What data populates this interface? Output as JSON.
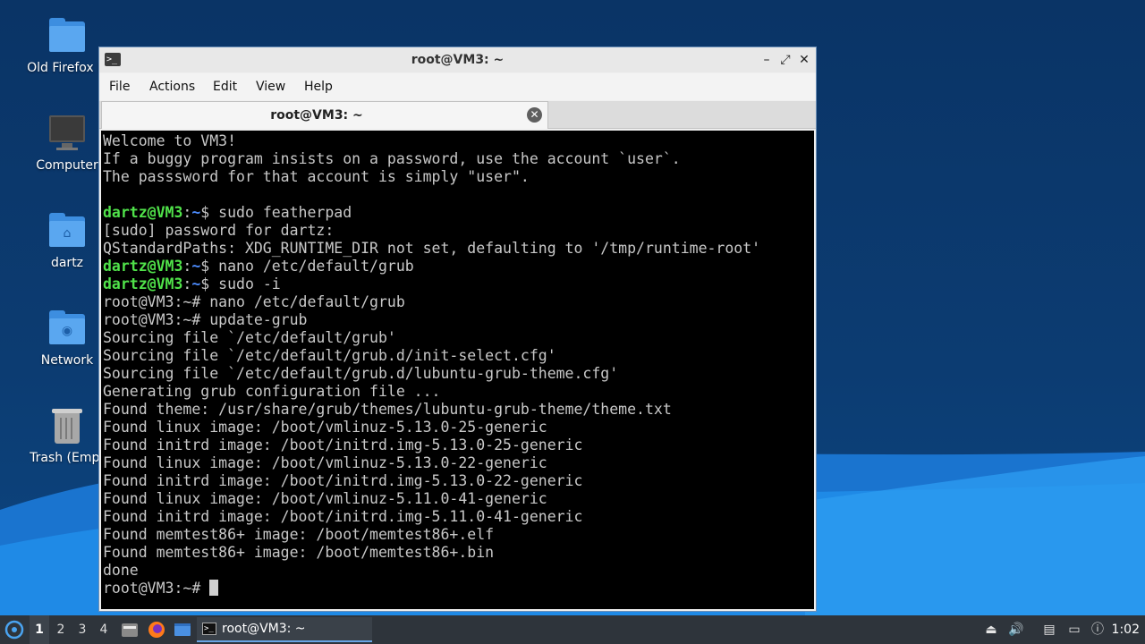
{
  "desktop": {
    "icons": [
      {
        "label": "Old Firefox D",
        "icon": "folder-icon"
      },
      {
        "label": "Computer",
        "icon": "computer-icon"
      },
      {
        "label": "dartz",
        "icon": "home-folder-icon"
      },
      {
        "label": "Network",
        "icon": "network-folder-icon"
      },
      {
        "label": "Trash (Empt",
        "icon": "trash-icon"
      }
    ]
  },
  "window": {
    "title": "root@VM3: ~",
    "menu": [
      "File",
      "Actions",
      "Edit",
      "View",
      "Help"
    ],
    "tab_label": "root@VM3: ~",
    "controls": {
      "minimize": "–",
      "maximize": "⤢",
      "close": "✕",
      "tab_close": "✕"
    }
  },
  "terminal": {
    "lines": [
      {
        "text": "Welcome to VM3!"
      },
      {
        "text": "If a buggy program insists on a password, use the account `user`."
      },
      {
        "text": "The passsword for that account is simply \"user\"."
      },
      {
        "text": ""
      },
      {
        "prompt": true,
        "user": "dartz@VM3",
        "path": "~",
        "cmd": "sudo featherpad"
      },
      {
        "text": "[sudo] password for dartz:"
      },
      {
        "text": "QStandardPaths: XDG_RUNTIME_DIR not set, defaulting to '/tmp/runtime-root'"
      },
      {
        "prompt": true,
        "user": "dartz@VM3",
        "path": "~",
        "cmd": "nano /etc/default/grub"
      },
      {
        "prompt": true,
        "user": "dartz@VM3",
        "path": "~",
        "cmd": "sudo -i"
      },
      {
        "text": "root@VM3:~# nano /etc/default/grub"
      },
      {
        "text": "root@VM3:~# update-grub"
      },
      {
        "text": "Sourcing file `/etc/default/grub'"
      },
      {
        "text": "Sourcing file `/etc/default/grub.d/init-select.cfg'"
      },
      {
        "text": "Sourcing file `/etc/default/grub.d/lubuntu-grub-theme.cfg'"
      },
      {
        "text": "Generating grub configuration file ..."
      },
      {
        "text": "Found theme: /usr/share/grub/themes/lubuntu-grub-theme/theme.txt"
      },
      {
        "text": "Found linux image: /boot/vmlinuz-5.13.0-25-generic"
      },
      {
        "text": "Found initrd image: /boot/initrd.img-5.13.0-25-generic"
      },
      {
        "text": "Found linux image: /boot/vmlinuz-5.13.0-22-generic"
      },
      {
        "text": "Found initrd image: /boot/initrd.img-5.13.0-22-generic"
      },
      {
        "text": "Found linux image: /boot/vmlinuz-5.11.0-41-generic"
      },
      {
        "text": "Found initrd image: /boot/initrd.img-5.11.0-41-generic"
      },
      {
        "text": "Found memtest86+ image: /boot/memtest86+.elf"
      },
      {
        "text": "Found memtest86+ image: /boot/memtest86+.bin"
      },
      {
        "text": "done"
      }
    ],
    "final_prompt": "root@VM3:~# ",
    "colors": {
      "user": "#50e24a",
      "path": "#4d8dff",
      "text": "#c8c8c8",
      "bg": "#000000"
    }
  },
  "taskbar": {
    "workspaces": [
      "1",
      "2",
      "3",
      "4"
    ],
    "active_workspace": "1",
    "launchers": [
      "file-manager-icon",
      "firefox-icon",
      "show-desktop-icon"
    ],
    "task_label": "root@VM3: ~",
    "tray": [
      "removable-media-icon",
      "volume-icon",
      "clipboard-icon",
      "network-icon",
      "update-notifier-icon"
    ],
    "clock": "1:02"
  }
}
